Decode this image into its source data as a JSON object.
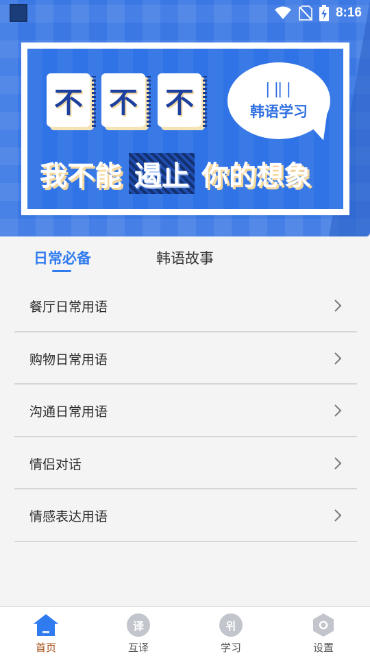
{
  "status_bar": {
    "time": "8:16",
    "icons": [
      "wifi-icon",
      "no-sim-icon",
      "battery-charging-icon"
    ]
  },
  "banner": {
    "tiles": [
      "不",
      "不",
      "不"
    ],
    "bubble_mark": "|‖|",
    "bubble_text": "韩语学习",
    "slogan_left": "我不能",
    "slogan_highlight": "遏止",
    "slogan_right": "你的想象"
  },
  "tabs": [
    {
      "label": "日常必备",
      "active": true
    },
    {
      "label": "韩语故事",
      "active": false
    }
  ],
  "list": [
    {
      "label": "餐厅日常用语"
    },
    {
      "label": "购物日常用语"
    },
    {
      "label": "沟通日常用语"
    },
    {
      "label": "情侣对话"
    },
    {
      "label": "情感表达用语"
    }
  ],
  "bottom_nav": [
    {
      "label": "首页",
      "icon": "home-icon",
      "active": true
    },
    {
      "label": "互译",
      "icon": "translate-icon",
      "glyph": "译",
      "active": false
    },
    {
      "label": "学习",
      "icon": "study-icon",
      "glyph": "위",
      "active": false
    },
    {
      "label": "设置",
      "icon": "settings-icon",
      "active": false
    }
  ],
  "colors": {
    "accent": "#2f7bef",
    "hero_blue": "#3b78e4",
    "active_nav_label": "#a24b12",
    "nav_icon_gray": "#c2c6cc"
  }
}
